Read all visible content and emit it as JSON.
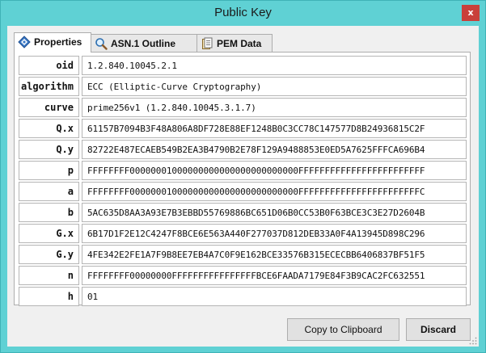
{
  "window": {
    "title": "Public Key",
    "close_label": "x"
  },
  "tabs": [
    {
      "label": "Properties",
      "icon": "properties-icon",
      "active": true
    },
    {
      "label": "ASN.1 Outline",
      "icon": "magnifier-icon",
      "active": false
    },
    {
      "label": "PEM Data",
      "icon": "document-icon",
      "active": false
    }
  ],
  "properties": [
    {
      "key": "oid",
      "value": "1.2.840.10045.2.1"
    },
    {
      "key": "algorithm",
      "value": "ECC (Elliptic-Curve Cryptography)"
    },
    {
      "key": "curve",
      "value": "prime256v1 (1.2.840.10045.3.1.7)"
    },
    {
      "key": "Q.x",
      "value": "61157B7094B3F48A806A8DF728E88EF1248B0C3CC78C147577D8B24936815C2F"
    },
    {
      "key": "Q.y",
      "value": "82722E487ECAEB549B2EA3B4790B2E78F129A9488853E0ED5A7625FFFCA696B4"
    },
    {
      "key": "p",
      "value": "FFFFFFFF00000001000000000000000000000000FFFFFFFFFFFFFFFFFFFFFFFF"
    },
    {
      "key": "a",
      "value": "FFFFFFFF00000001000000000000000000000000FFFFFFFFFFFFFFFFFFFFFFFC"
    },
    {
      "key": "b",
      "value": "5AC635D8AA3A93E7B3EBBD55769886BC651D06B0CC53B0F63BCE3C3E27D2604B"
    },
    {
      "key": "G.x",
      "value": "6B17D1F2E12C4247F8BCE6E563A440F277037D812DEB33A0F4A13945D898C296"
    },
    {
      "key": "G.y",
      "value": "4FE342E2FE1A7F9B8EE7EB4A7C0F9E162BCE33576B315ECECBB6406837BF51F5"
    },
    {
      "key": "n",
      "value": "FFFFFFFF00000000FFFFFFFFFFFFFFFFBCE6FAADA7179E84F3B9CAC2FC632551"
    },
    {
      "key": "h",
      "value": "01"
    }
  ],
  "buttons": {
    "copy": "Copy to Clipboard",
    "discard": "Discard"
  }
}
